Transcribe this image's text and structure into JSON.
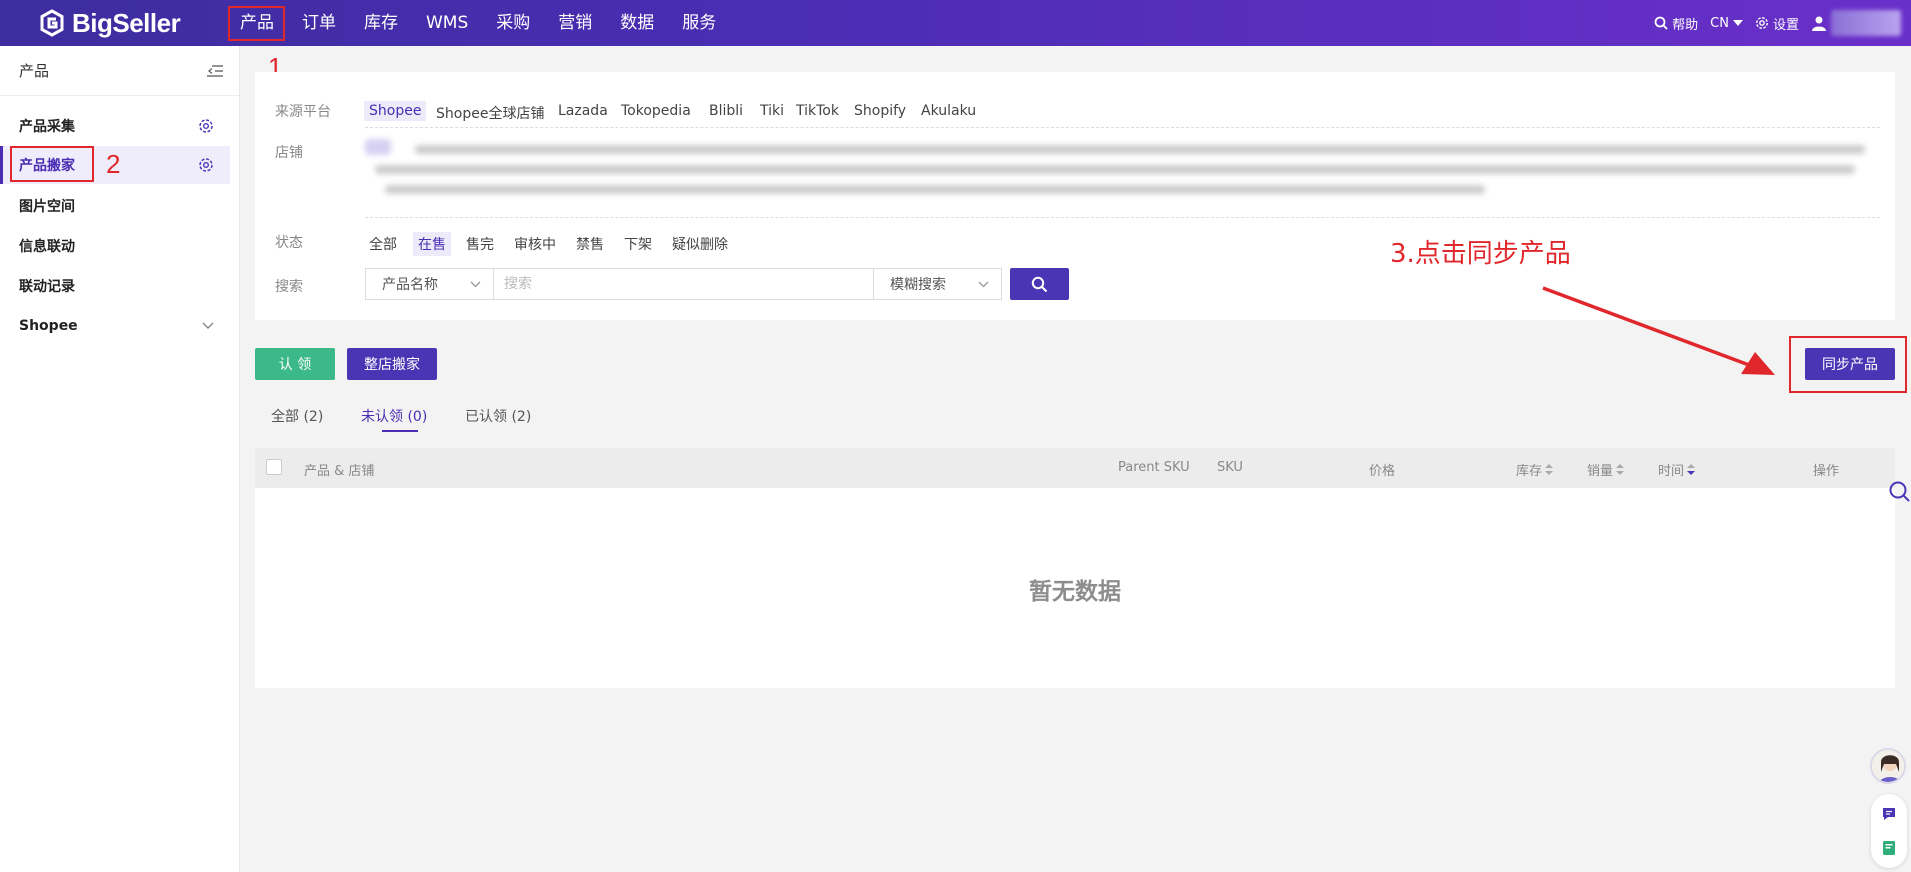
{
  "brand": {
    "name": "BigSeller"
  },
  "nav": {
    "items": [
      "产品",
      "订单",
      "库存",
      "WMS",
      "采购",
      "营销",
      "数据",
      "服务"
    ],
    "help": "帮助",
    "lang": "CN",
    "settings": "设置"
  },
  "annotations": {
    "n1": "1",
    "n2": "2",
    "n3": "3.点击同步产品"
  },
  "sidebar": {
    "title": "产品",
    "items": [
      "产品采集",
      "产品搬家",
      "图片空间",
      "信息联动",
      "联动记录",
      "Shopee"
    ]
  },
  "filters": {
    "platform_label": "来源平台",
    "platforms": [
      "Shopee",
      "Shopee全球店铺",
      "Lazada",
      "Tokopedia",
      "Blibli",
      "Tiki",
      "TikTok",
      "Shopify",
      "Akulaku"
    ],
    "store_label": "店铺",
    "status_label": "状态",
    "statuses": [
      "全部",
      "在售",
      "售完",
      "审核中",
      "禁售",
      "下架",
      "疑似删除"
    ],
    "search_label": "搜索",
    "search_field": "产品名称",
    "search_placeholder": "搜索",
    "search_mode": "模糊搜索"
  },
  "actions": {
    "claim": "认 领",
    "move_store": "整店搬家",
    "sync": "同步产品"
  },
  "tabs": [
    "全部 (2)",
    "未认领 (0)",
    "已认领 (2)"
  ],
  "table": {
    "columns": [
      "产品 & 店铺",
      "Parent SKU",
      "SKU",
      "价格",
      "库存",
      "销量",
      "时间",
      "操作"
    ],
    "empty": "暂无数据"
  },
  "colors": {
    "primary": "#4a35b5",
    "claim_green": "#3cb98a",
    "annotation_red": "#e0282c"
  }
}
